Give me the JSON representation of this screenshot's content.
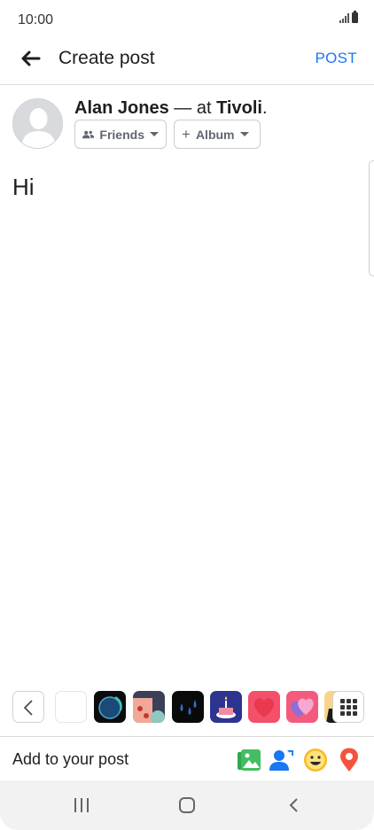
{
  "status_bar": {
    "time": "10:00"
  },
  "header": {
    "title": "Create post",
    "post_label": "POST"
  },
  "author": {
    "name": "Alan Jones",
    "connector": "— at",
    "place": "Tivoli",
    "end": "."
  },
  "audience": {
    "friends_label": "Friends",
    "album_label": "Album"
  },
  "post": {
    "text": "Hi"
  },
  "stickers": {
    "items": [
      "blank",
      "blue-disc",
      "pink-abstract",
      "raindrops",
      "cake",
      "red-heart",
      "pink-hearts",
      "character"
    ]
  },
  "add_to_post": {
    "label": "Add to your post",
    "icons": [
      "photo-icon",
      "tag-people-icon",
      "feeling-icon",
      "location-icon"
    ],
    "colors": {
      "photo": "#45bd62",
      "tag": "#1877f2",
      "feeling": "#f7b928",
      "location": "#f5533d"
    }
  },
  "colors": {
    "accent": "#1877f2"
  }
}
